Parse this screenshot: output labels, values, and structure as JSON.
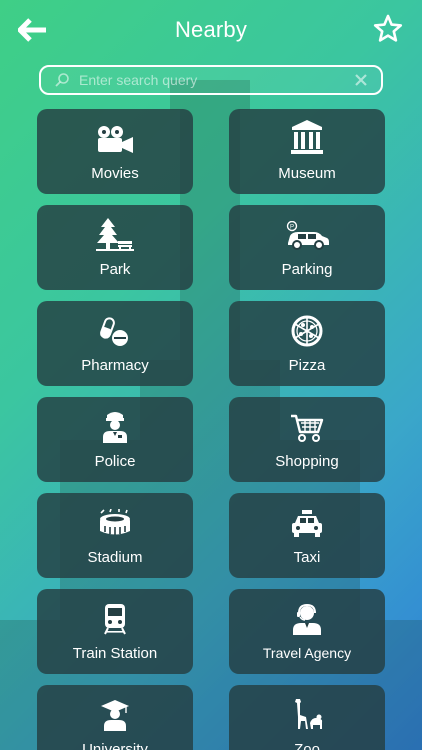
{
  "header": {
    "title": "Nearby"
  },
  "search": {
    "placeholder": "Enter search query"
  },
  "categories": [
    {
      "label": "Movies",
      "icon": "film-camera-icon"
    },
    {
      "label": "Museum",
      "icon": "museum-icon"
    },
    {
      "label": "Park",
      "icon": "tree-bench-icon"
    },
    {
      "label": "Parking",
      "icon": "parking-car-icon"
    },
    {
      "label": "Pharmacy",
      "icon": "pills-icon"
    },
    {
      "label": "Pizza",
      "icon": "pizza-icon"
    },
    {
      "label": "Police",
      "icon": "police-officer-icon"
    },
    {
      "label": "Shopping",
      "icon": "shopping-cart-icon"
    },
    {
      "label": "Stadium",
      "icon": "stadium-icon"
    },
    {
      "label": "Taxi",
      "icon": "taxi-icon"
    },
    {
      "label": "Train Station",
      "icon": "train-icon"
    },
    {
      "label": "Travel Agency",
      "icon": "travel-agent-icon"
    },
    {
      "label": "University",
      "icon": "graduation-cap-icon"
    },
    {
      "label": "Zoo",
      "icon": "giraffe-icon"
    }
  ],
  "colors": {
    "gradient_start": "#3fcf86",
    "gradient_end": "#2f7fd8",
    "tile": "#243e42"
  }
}
